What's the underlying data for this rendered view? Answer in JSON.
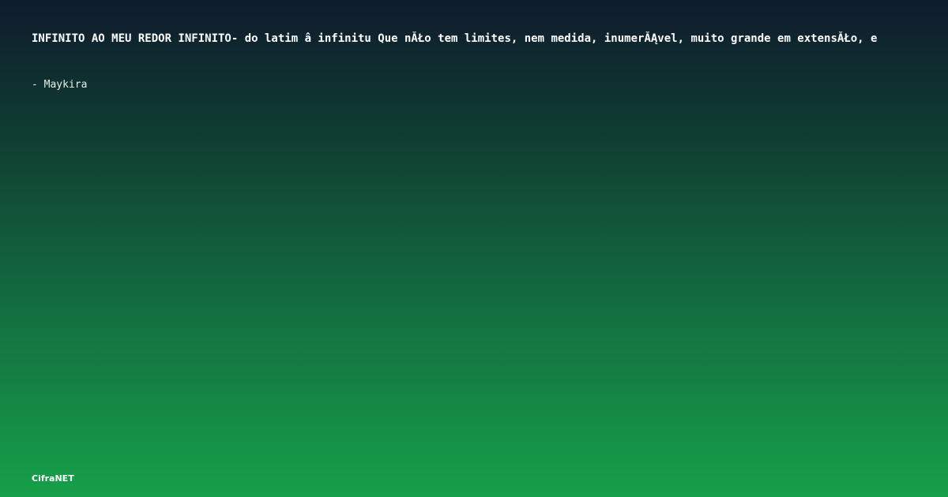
{
  "card": {
    "lyric_text": "INFINITO AO MEU REDOR INFINITO- do latim â   infinitu Que nĂŁo tem limites, nem medida, inumerĂĄvel, muito grande em extensĂŁo, e",
    "author": "- Maykira",
    "brand": "CifraNET"
  },
  "colors": {
    "gradient_top": "#0f1b2e",
    "gradient_bottom": "#16a049",
    "text": "#ffffff"
  }
}
